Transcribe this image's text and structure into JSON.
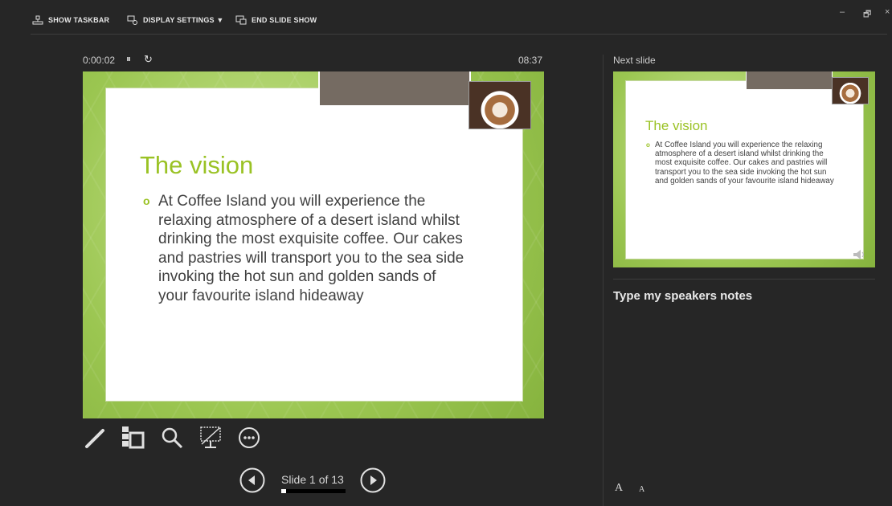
{
  "toolbar": {
    "show_taskbar": "SHOW TASKBAR",
    "display_settings": "DISPLAY SETTINGS ▼",
    "end_slide_show": "END SLIDE SHOW"
  },
  "window": {
    "minimize": "–",
    "restore": "🗗",
    "close": "×"
  },
  "timer": {
    "elapsed": "0:00:02",
    "pause_glyph": "⏸",
    "reset_glyph": "↻",
    "clock": "08:37"
  },
  "current_slide": {
    "title": "The vision",
    "bullet": "o",
    "body": "At Coffee Island you will experience the relaxing atmosphere of a desert island whilst drinking the most exquisite coffee. Our cakes and pastries will transport you to the sea side invoking the hot sun and golden sands of your favourite island hideaway"
  },
  "tools": [
    "pen-icon",
    "slides-grid-icon",
    "zoom-icon",
    "black-screen-icon",
    "more-options-icon"
  ],
  "navigation": {
    "slide_text": "Slide 1 of 13",
    "progress": 0.077
  },
  "next_slide": {
    "label": "Next slide",
    "title": "The vision",
    "bullet": "o",
    "body": "At Coffee Island you will experience the relaxing atmosphere of a desert island whilst drinking the most exquisite coffee. Our cakes and pastries will transport you to the sea side invoking the hot sun and golden sands of your favourite island hideaway"
  },
  "notes": {
    "text": "Type my speakers notes"
  },
  "font_size": {
    "increase": "A",
    "decrease": "A"
  },
  "colors": {
    "background": "#262626",
    "accent_green": "#9ac224",
    "slide_frame": "#9bc651",
    "tab_brown": "#756b62"
  }
}
